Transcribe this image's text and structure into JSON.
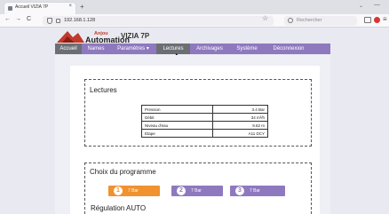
{
  "browser": {
    "tab_title": "Accueil VIZIA 7P",
    "tab_close": "×",
    "new_tab": "+",
    "url": "192.168.1.128",
    "search_placeholder": "Rechercher",
    "tabs_menu": "⌄",
    "minimize": "—",
    "back": "←",
    "forward": "→",
    "reload": "C",
    "menu": "≡",
    "star": "☆"
  },
  "header": {
    "logo_top": "Anjou",
    "logo_bottom": "Automation",
    "app_title": "VIZIA 7P"
  },
  "nav": {
    "items": [
      "Accueil",
      "Names",
      "Paramètres ▾",
      "Lectures",
      "Archivages",
      "Système",
      "Déconnexion"
    ],
    "active_index": 3
  },
  "lectures": {
    "title": "Lectures",
    "rows": [
      {
        "label": "Pression",
        "value": "3.4 Bar"
      },
      {
        "label": "Débit",
        "value": "34 m³/h"
      },
      {
        "label": "Niveau d'eau",
        "value": "9.62 m"
      },
      {
        "label": "Etape",
        "value": "A11 DCY"
      }
    ]
  },
  "programme": {
    "title": "Choix du programme",
    "buttons": [
      {
        "num": "1",
        "label": "7 Bar",
        "color": "#f0922e"
      },
      {
        "num": "2",
        "label": "7 Bar",
        "color": "#8e79bf"
      },
      {
        "num": "3",
        "label": "7 Bar",
        "color": "#8e79bf"
      }
    ]
  },
  "regulation": {
    "title": "Régulation AUTO"
  },
  "colors": {
    "nav_bg": "#8e79bf",
    "nav_active": "#6b6f74",
    "accent_orange": "#f0922e",
    "logo_red": "#c0392b"
  }
}
